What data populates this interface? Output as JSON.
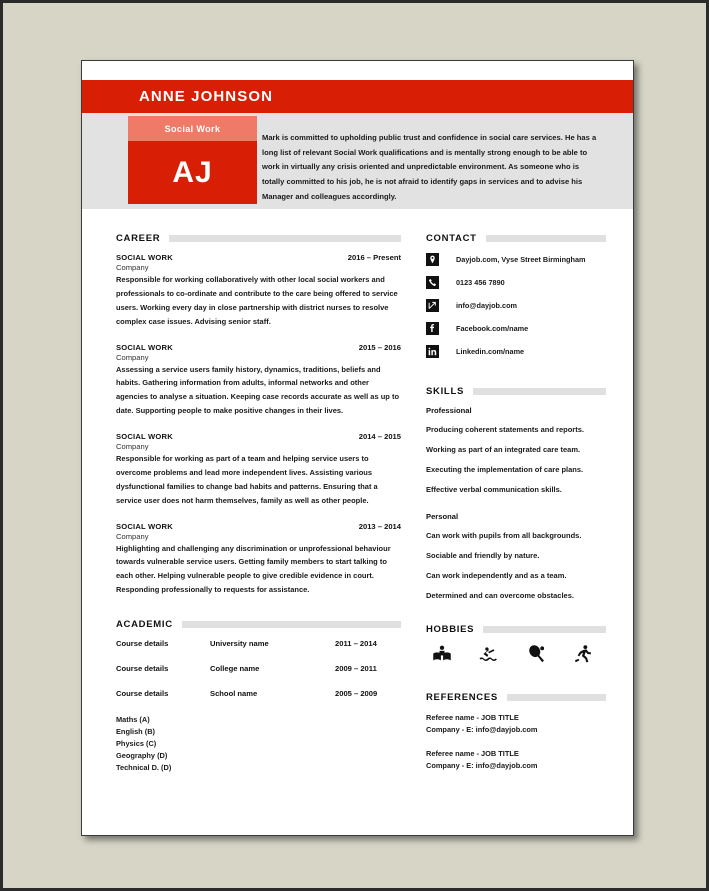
{
  "theme": {
    "accent_red": "#d81f06",
    "accent_light_red": "#ef7a68",
    "band_gray": "#e2e2e2",
    "rule_gray": "#e0e0e0",
    "desk_background": "#d6d5c6",
    "page_white": "#ffffff"
  },
  "header": {
    "full_name": "ANNE JOHNSON",
    "badge_title": "Social Work",
    "badge_initials": "AJ",
    "profile_summary": "Mark is committed to upholding public trust and confidence in social care services. He has a long list of relevant Social Work qualifications and is mentally strong enough to be able to work in virtually any crisis oriented and unpredictable environment. As someone who is totally committed to his job, he is not afraid to identify gaps in services and to advise his Manager and colleagues accordingly."
  },
  "career": {
    "heading": "CAREER",
    "jobs": [
      {
        "title": "SOCIAL WORK",
        "dates": "2016 – Present",
        "company": "Company",
        "description": "Responsible for working collaboratively with other local social workers and professionals to co-ordinate and contribute to the care being offered to service users. Working every day in close partnership with district nurses to resolve complex case issues. Advising senior staff."
      },
      {
        "title": "SOCIAL WORK",
        "dates": "2015 – 2016",
        "company": "Company",
        "description": "Assessing a service users family history, dynamics, traditions, beliefs and habits. Gathering information from adults, informal networks and other agencies to analyse a situation. Keeping case records accurate as well as up to date. Supporting people to make positive changes in their lives."
      },
      {
        "title": "SOCIAL WORK",
        "dates": "2014 – 2015",
        "company": "Company",
        "description": "Responsible for working as part of a team and helping service users to overcome problems and lead more independent lives. Assisting various dysfunctional families to change bad habits and patterns. Ensuring that a service user does not harm themselves, family as well as other people."
      },
      {
        "title": "SOCIAL WORK",
        "dates": "2013 – 2014",
        "company": "Company",
        "description": "Highlighting and challenging any discrimination or unprofessional behaviour towards vulnerable service users. Getting family members to start talking to each other. Helping vulnerable people to give credible evidence in court. Responding professionally to requests for assistance."
      }
    ]
  },
  "academic": {
    "heading": "ACADEMIC",
    "entries": [
      {
        "course": "Course details",
        "institution": "University name",
        "years": "2011 – 2014"
      },
      {
        "course": "Course details",
        "institution": "College name",
        "years": "2009 – 2011"
      },
      {
        "course": "Course details",
        "institution": "School name",
        "years": "2005 – 2009"
      }
    ],
    "grades": [
      "Maths (A)",
      "English (B)",
      "Physics (C)",
      "Geography (D)",
      "Technical D. (D)"
    ]
  },
  "contact": {
    "heading": "CONTACT",
    "items": [
      {
        "icon": "location-pin-icon",
        "text": "Dayjob.com, Vyse Street Birmingham"
      },
      {
        "icon": "phone-icon",
        "text": "0123 456 7890"
      },
      {
        "icon": "email-icon",
        "text": "info@dayjob.com"
      },
      {
        "icon": "facebook-icon",
        "text": "Facebook.com/name"
      },
      {
        "icon": "linkedin-icon",
        "text": "Linkedin.com/name"
      }
    ]
  },
  "skills": {
    "heading": "SKILLS",
    "professional_label": "Professional",
    "professional": [
      "Producing coherent statements and reports.",
      "Working as part of an integrated care team.",
      "Executing the implementation of care plans.",
      "Effective verbal communication skills."
    ],
    "personal_label": "Personal",
    "personal": [
      "Can work with pupils from all backgrounds.",
      "Sociable and friendly by nature.",
      "Can work independently and as a team.",
      "Determined and can overcome obstacles."
    ]
  },
  "hobbies": {
    "heading": "HOBBIES",
    "icons": [
      "reading-icon",
      "swimming-icon",
      "table-tennis-icon",
      "running-icon"
    ]
  },
  "references": {
    "heading": "REFERENCES",
    "entries": [
      {
        "name_title": "Referee name - JOB TITLE",
        "company_email": "Company - E: info@dayjob.com"
      },
      {
        "name_title": "Referee name - JOB TITLE",
        "company_email": "Company - E: info@dayjob.com"
      }
    ]
  }
}
